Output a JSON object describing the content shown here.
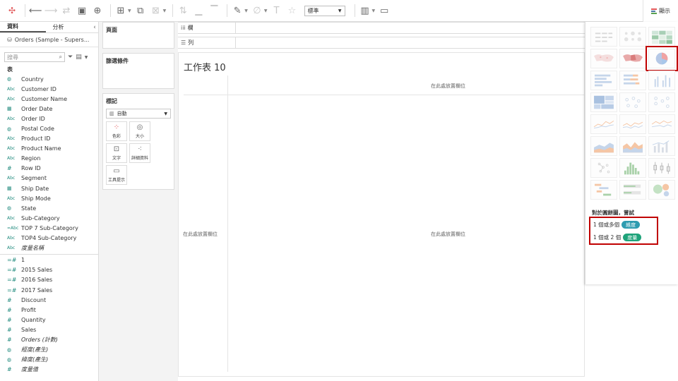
{
  "toolbar": {
    "fit_select": "標準",
    "show_me_label": "顯示"
  },
  "data_pane": {
    "tabs": [
      "資料",
      "分析"
    ],
    "datasource": "Orders (Sample - Supers...",
    "search_placeholder": "搜尋",
    "tables_header": "表",
    "dimensions": [
      {
        "icon": "globe",
        "name": "Country"
      },
      {
        "icon": "abc",
        "name": "Customer ID"
      },
      {
        "icon": "abc",
        "name": "Customer Name"
      },
      {
        "icon": "calendar",
        "name": "Order Date"
      },
      {
        "icon": "abc",
        "name": "Order ID"
      },
      {
        "icon": "globe",
        "name": "Postal Code"
      },
      {
        "icon": "abc",
        "name": "Product ID"
      },
      {
        "icon": "abc",
        "name": "Product Name"
      },
      {
        "icon": "abc",
        "name": "Region"
      },
      {
        "icon": "hash",
        "name": "Row ID"
      },
      {
        "icon": "abc",
        "name": "Segment"
      },
      {
        "icon": "calendar",
        "name": "Ship Date"
      },
      {
        "icon": "abc",
        "name": "Ship Mode"
      },
      {
        "icon": "globe",
        "name": "State"
      },
      {
        "icon": "abc",
        "name": "Sub-Category"
      },
      {
        "icon": "abc-calc",
        "name": "TOP 7 Sub-Category"
      },
      {
        "icon": "abc",
        "name": "TOP4 Sub-Category"
      },
      {
        "icon": "abc",
        "name": "度量名稱",
        "italic": true
      }
    ],
    "measures": [
      {
        "icon": "hash-calc",
        "name": "1"
      },
      {
        "icon": "hash-calc",
        "name": "2015 Sales"
      },
      {
        "icon": "hash-calc",
        "name": "2016 Sales"
      },
      {
        "icon": "hash-calc",
        "name": "2017 Sales"
      },
      {
        "icon": "hash",
        "name": "Discount"
      },
      {
        "icon": "hash",
        "name": "Profit"
      },
      {
        "icon": "hash",
        "name": "Quantity"
      },
      {
        "icon": "hash",
        "name": "Sales"
      },
      {
        "icon": "hash",
        "name": "Orders (計數)",
        "italic": true
      },
      {
        "icon": "globe",
        "name": "經度(產生)",
        "italic": true
      },
      {
        "icon": "globe",
        "name": "緯度(產生)",
        "italic": true
      },
      {
        "icon": "hash",
        "name": "度量值",
        "italic": true
      }
    ]
  },
  "cards": {
    "pages": "頁面",
    "filters": "篩選條件",
    "marks": "標記",
    "marks_type": "自動",
    "marks_buttons": [
      {
        "icon": "color",
        "label": "色彩"
      },
      {
        "icon": "size",
        "label": "大小"
      },
      {
        "icon": "text",
        "label": "文字"
      },
      {
        "icon": "detail",
        "label": "詳細資料"
      },
      {
        "icon": "tooltip",
        "label": "工具提示"
      }
    ]
  },
  "shelves": {
    "columns": "欄",
    "rows": "列"
  },
  "canvas": {
    "title": "工作表 10",
    "drop_top": "在此處放置欄位",
    "drop_left": "在此處放置欄位",
    "drop_center": "在此處放置欄位"
  },
  "show_me": {
    "hint_title": "對於圓餅圖，嘗試",
    "hint_rows": [
      {
        "text": "1 個或多個",
        "pill": "維度"
      },
      {
        "text": "1 個或 2 個",
        "pill": "度量"
      }
    ],
    "colors": {
      "dimension_pill": "#2e9cb0",
      "measure_pill": "#1fa37a",
      "highlight": "#c00000"
    }
  }
}
